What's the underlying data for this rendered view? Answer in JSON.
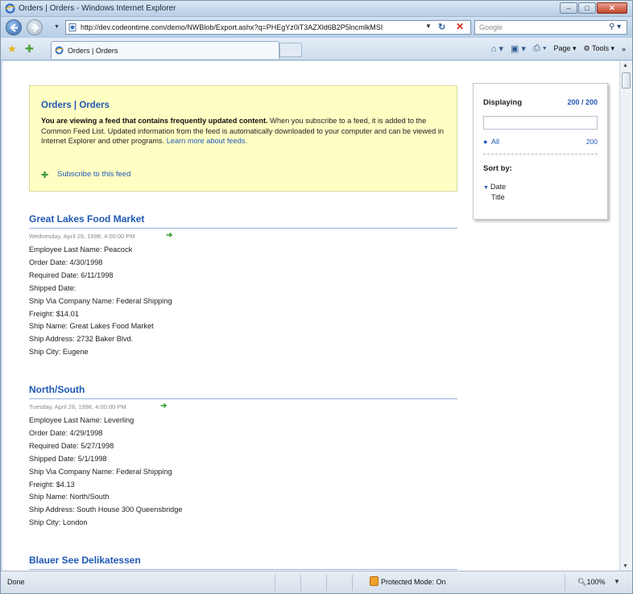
{
  "window": {
    "title": "Orders | Orders - Windows Internet Explorer",
    "controls": {
      "minimize": "–",
      "maximize": "□",
      "close": "✕"
    }
  },
  "address_bar": {
    "url": "http://dev.codeontime.com/demo/NWBlob/Export.ashx?q=PHEgYz0iT3AZXld6B2P5lncmlkMSI",
    "search_placeholder": "Google"
  },
  "tab": {
    "label": "Orders | Orders"
  },
  "commands": {
    "page": "Page",
    "tools": "Tools"
  },
  "feed_info": {
    "title": "Orders | Orders",
    "description_bold": "You are viewing a feed that contains frequently updated content.",
    "description_rest": " When you subscribe to a feed, it is added to the Common Feed List. Updated information from the feed is automatically downloaded to your computer and can be viewed in Internet Explorer and other programs. ",
    "learn_more": "Learn more about feeds.",
    "subscribe": "Subscribe to this feed"
  },
  "side_panel": {
    "displaying_label": "Displaying",
    "displaying_value": "200 / 200",
    "filter_all_label": "All",
    "filter_all_count": "200",
    "sort_by_label": "Sort by:",
    "sort_options": [
      "Date",
      "Title"
    ]
  },
  "entries": [
    {
      "title": "Great Lakes Food Market",
      "date": "Wednesday, April 29, 1998, 4:00:00 PM",
      "fields": [
        "Employee Last Name: Peacock",
        "Order Date: 4/30/1998",
        "Required Date: 6/11/1998",
        "Shipped Date:",
        "Ship Via Company Name: Federal Shipping",
        "Freight: $14.01",
        "Ship Name: Great Lakes Food Market",
        "Ship Address: 2732 Baker Blvd.",
        "Ship City: Eugene"
      ]
    },
    {
      "title": "North/South",
      "date": "Tuesday, April 28, 1998, 4:00:00 PM",
      "fields": [
        "Employee Last Name: Leverling",
        "Order Date: 4/29/1998",
        "Required Date: 5/27/1998",
        "Shipped Date: 5/1/1998",
        "Ship Via Company Name: Federal Shipping",
        "Freight: $4.13",
        "Ship Name: North/South",
        "Ship Address: South House 300 Queensbridge",
        "Ship City: London"
      ]
    },
    {
      "title": "Blauer See Delikatessen",
      "date": "",
      "fields": []
    }
  ],
  "status_bar": {
    "status": "Done",
    "protected_mode": "Protected Mode: On",
    "zoom": "100%"
  }
}
